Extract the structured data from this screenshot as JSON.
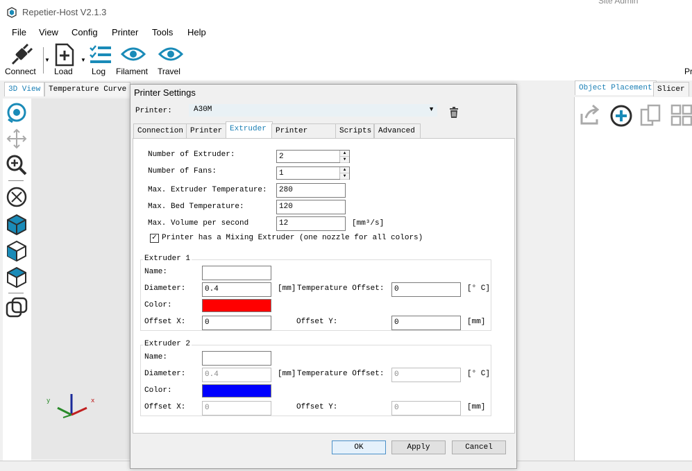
{
  "window": {
    "title": "Repetier-Host V2.1.3",
    "background_text": "Site Admin"
  },
  "menu": [
    "File",
    "View",
    "Config",
    "Printer",
    "Tools",
    "Help"
  ],
  "toolbar": {
    "connect": "Connect",
    "load": "Load",
    "log": "Log",
    "filament": "Filament",
    "travel": "Travel",
    "cut_label": "Pr"
  },
  "left_tabs": [
    "3D View",
    "Temperature Curve"
  ],
  "right_tabs": [
    "Object Placement",
    "Slicer"
  ],
  "dialog": {
    "title": "Printer Settings",
    "printer_label": "Printer:",
    "printer_value": "A30M",
    "tabs": [
      "Connection",
      "Printer",
      "Extruder",
      "Printer Shape",
      "Scripts",
      "Advanced"
    ],
    "active_tab": "Extruder",
    "fields": {
      "num_extruder_label": "Number of Extruder:",
      "num_extruder_value": "2",
      "num_fans_label": "Number of Fans:",
      "num_fans_value": "1",
      "max_extruder_temp_label": "Max. Extruder Temperature:",
      "max_extruder_temp_value": "280",
      "max_bed_temp_label": "Max. Bed Temperature:",
      "max_bed_temp_value": "120",
      "max_volume_label": "Max. Volume per second",
      "max_volume_value": "12",
      "max_volume_unit": "[mm³/s]",
      "mixing_label": "Printer has a Mixing Extruder (one nozzle for all colors)",
      "mixing_checked": true
    },
    "extruders": [
      {
        "title": "Extruder 1",
        "name_label": "Name:",
        "name_value": "",
        "diameter_label": "Diameter:",
        "diameter_value": "0.4",
        "diameter_unit": "[mm]",
        "temp_offset_label": "Temperature Offset:",
        "temp_offset_value": "0",
        "temp_unit": "[° C]",
        "color_label": "Color:",
        "color": "#ff0000",
        "offset_x_label": "Offset X:",
        "offset_x_value": "0",
        "offset_y_label": "Offset Y:",
        "offset_y_value": "0",
        "offset_unit": "[mm]"
      },
      {
        "title": "Extruder 2",
        "name_label": "Name:",
        "name_value": "",
        "diameter_label": "Diameter:",
        "diameter_value": "0.4",
        "diameter_unit": "[mm]",
        "temp_offset_label": "Temperature Offset:",
        "temp_offset_value": "0",
        "temp_unit": "[° C]",
        "color_label": "Color:",
        "color": "#0000ff",
        "offset_x_label": "Offset X:",
        "offset_x_value": "0",
        "offset_y_label": "Offset Y:",
        "offset_y_value": "0",
        "offset_unit": "[mm]"
      }
    ],
    "buttons": {
      "ok": "OK",
      "apply": "Apply",
      "cancel": "Cancel"
    }
  },
  "colors": {
    "accent": "#1a8bb8",
    "icon_dark": "#2d2d2d"
  }
}
